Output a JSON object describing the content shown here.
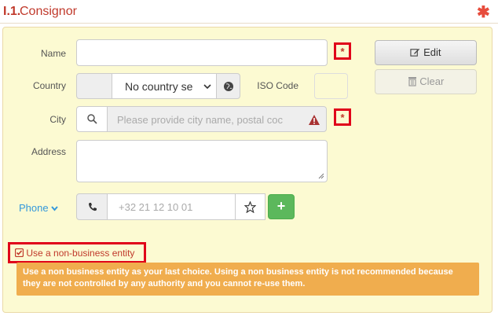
{
  "section": {
    "number": "I.1.",
    "title": "Consignor",
    "required_mark": "✱"
  },
  "form": {
    "name_label": "Name",
    "name_value": "",
    "name_required": "*",
    "country_label": "Country",
    "country_select": "No country se",
    "iso_label": "ISO Code",
    "iso_value": "",
    "city_label": "City",
    "city_placeholder": "Please provide city name, postal coc",
    "city_required": "*",
    "address_label": "Address",
    "address_value": "",
    "phone_label": "Phone",
    "phone_placeholder": "+32 21 12 10 01"
  },
  "buttons": {
    "edit": "Edit",
    "clear": "Clear",
    "add": "+"
  },
  "non_business": {
    "checkbox_label": "Use a non-business entity",
    "checked": true,
    "warning": "Use a non business entity as your last choice. Using a non business entity is not recommended because they are not controlled by any authority and you cannot re-use them."
  },
  "colors": {
    "panel_bg": "#fcfad2",
    "accent_red": "#c0392b",
    "highlight_red": "#e0001a",
    "warning_bg": "#f0ad4e",
    "add_green": "#5cb85c",
    "link_blue": "#3498db"
  }
}
